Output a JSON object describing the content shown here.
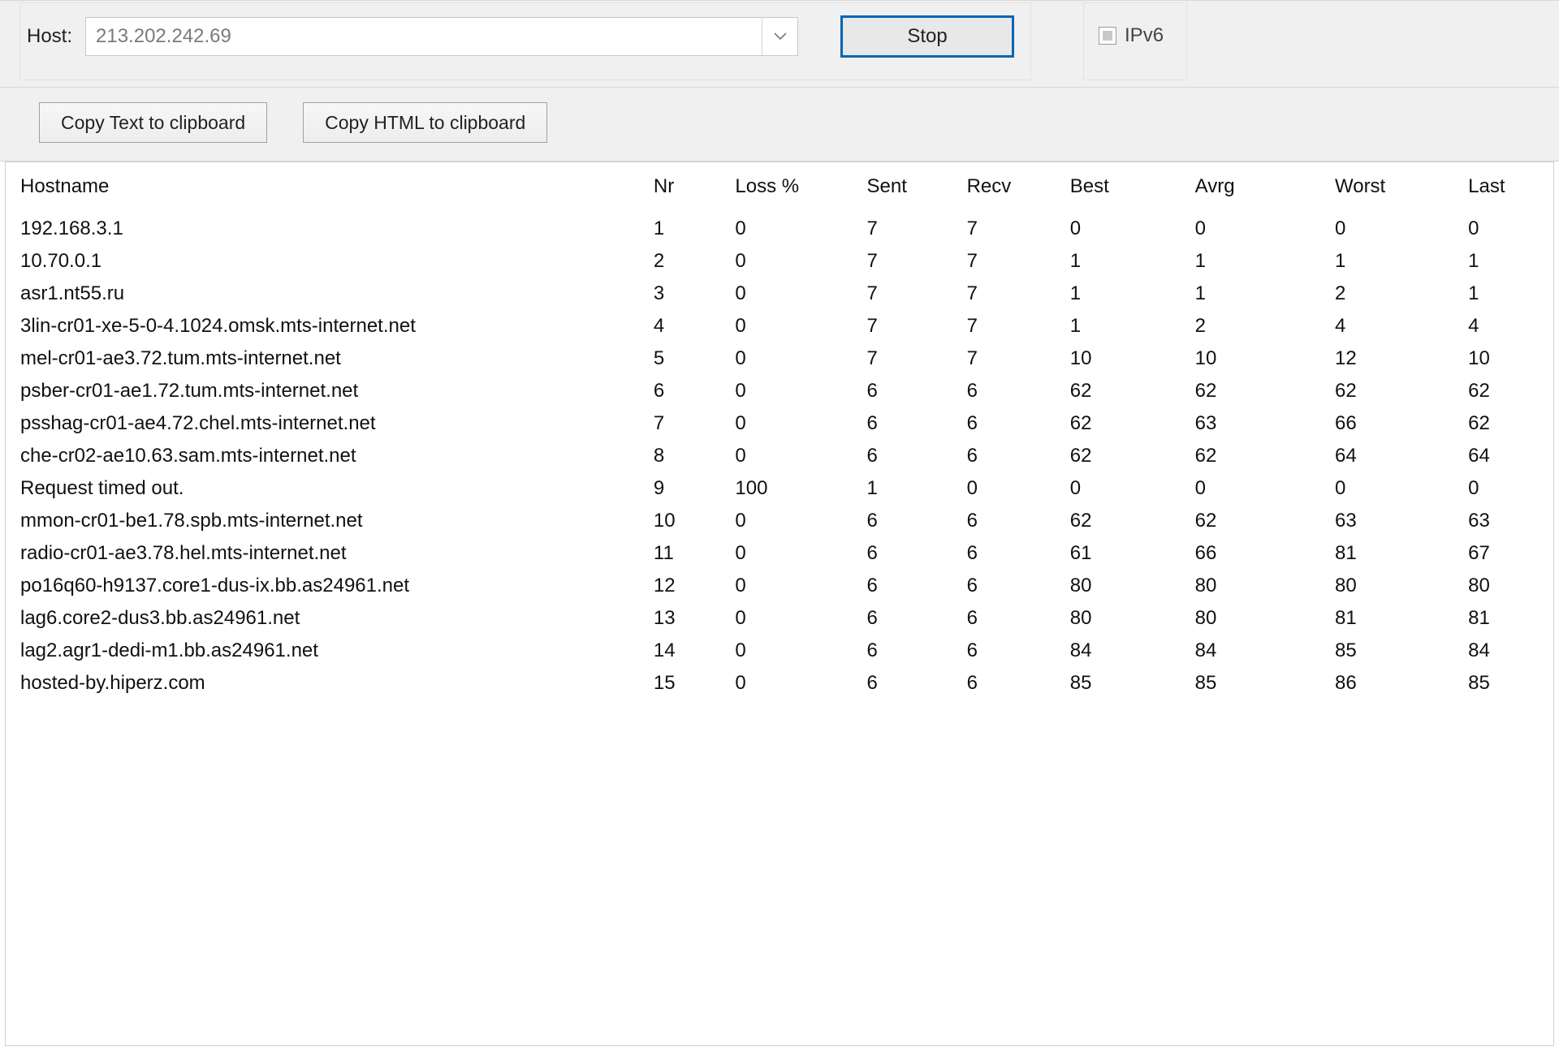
{
  "host": {
    "label": "Host:",
    "value": "213.202.242.69"
  },
  "stop_button": "Stop",
  "ipv6_label": "IPv6",
  "toolbar": {
    "copy_text": "Copy Text to clipboard",
    "copy_html": "Copy HTML to clipboard"
  },
  "columns": {
    "hostname": "Hostname",
    "nr": "Nr",
    "loss": "Loss %",
    "sent": "Sent",
    "recv": "Recv",
    "best": "Best",
    "avrg": "Avrg",
    "worst": "Worst",
    "last": "Last"
  },
  "rows": [
    {
      "hostname": "192.168.3.1",
      "nr": 1,
      "loss": 0,
      "sent": 7,
      "recv": 7,
      "best": 0,
      "avrg": 0,
      "worst": 0,
      "last": 0
    },
    {
      "hostname": "10.70.0.1",
      "nr": 2,
      "loss": 0,
      "sent": 7,
      "recv": 7,
      "best": 1,
      "avrg": 1,
      "worst": 1,
      "last": 1
    },
    {
      "hostname": "asr1.nt55.ru",
      "nr": 3,
      "loss": 0,
      "sent": 7,
      "recv": 7,
      "best": 1,
      "avrg": 1,
      "worst": 2,
      "last": 1
    },
    {
      "hostname": "3lin-cr01-xe-5-0-4.1024.omsk.mts-internet.net",
      "nr": 4,
      "loss": 0,
      "sent": 7,
      "recv": 7,
      "best": 1,
      "avrg": 2,
      "worst": 4,
      "last": 4
    },
    {
      "hostname": "mel-cr01-ae3.72.tum.mts-internet.net",
      "nr": 5,
      "loss": 0,
      "sent": 7,
      "recv": 7,
      "best": 10,
      "avrg": 10,
      "worst": 12,
      "last": 10
    },
    {
      "hostname": "psber-cr01-ae1.72.tum.mts-internet.net",
      "nr": 6,
      "loss": 0,
      "sent": 6,
      "recv": 6,
      "best": 62,
      "avrg": 62,
      "worst": 62,
      "last": 62
    },
    {
      "hostname": "psshag-cr01-ae4.72.chel.mts-internet.net",
      "nr": 7,
      "loss": 0,
      "sent": 6,
      "recv": 6,
      "best": 62,
      "avrg": 63,
      "worst": 66,
      "last": 62
    },
    {
      "hostname": "che-cr02-ae10.63.sam.mts-internet.net",
      "nr": 8,
      "loss": 0,
      "sent": 6,
      "recv": 6,
      "best": 62,
      "avrg": 62,
      "worst": 64,
      "last": 64
    },
    {
      "hostname": "Request timed out.",
      "nr": 9,
      "loss": 100,
      "sent": 1,
      "recv": 0,
      "best": 0,
      "avrg": 0,
      "worst": 0,
      "last": 0
    },
    {
      "hostname": "mmon-cr01-be1.78.spb.mts-internet.net",
      "nr": 10,
      "loss": 0,
      "sent": 6,
      "recv": 6,
      "best": 62,
      "avrg": 62,
      "worst": 63,
      "last": 63
    },
    {
      "hostname": "radio-cr01-ae3.78.hel.mts-internet.net",
      "nr": 11,
      "loss": 0,
      "sent": 6,
      "recv": 6,
      "best": 61,
      "avrg": 66,
      "worst": 81,
      "last": 67
    },
    {
      "hostname": "po16q60-h9137.core1-dus-ix.bb.as24961.net",
      "nr": 12,
      "loss": 0,
      "sent": 6,
      "recv": 6,
      "best": 80,
      "avrg": 80,
      "worst": 80,
      "last": 80
    },
    {
      "hostname": "lag6.core2-dus3.bb.as24961.net",
      "nr": 13,
      "loss": 0,
      "sent": 6,
      "recv": 6,
      "best": 80,
      "avrg": 80,
      "worst": 81,
      "last": 81
    },
    {
      "hostname": "lag2.agr1-dedi-m1.bb.as24961.net",
      "nr": 14,
      "loss": 0,
      "sent": 6,
      "recv": 6,
      "best": 84,
      "avrg": 84,
      "worst": 85,
      "last": 84
    },
    {
      "hostname": "hosted-by.hiperz.com",
      "nr": 15,
      "loss": 0,
      "sent": 6,
      "recv": 6,
      "best": 85,
      "avrg": 85,
      "worst": 86,
      "last": 85
    }
  ]
}
